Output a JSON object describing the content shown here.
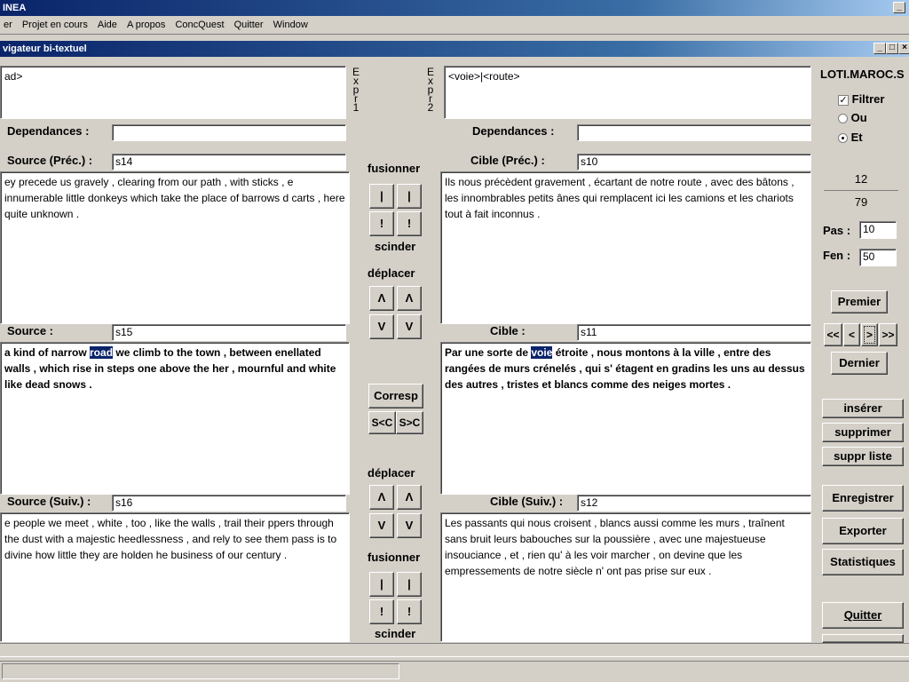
{
  "app": {
    "title": "INEA"
  },
  "menu": {
    "items": [
      "er",
      "Projet en cours",
      "Aide",
      "A propos",
      "ConcQuest",
      "Quitter",
      "Window"
    ]
  },
  "child": {
    "title": "vigateur bi-textuel"
  },
  "expr1": {
    "value": "ad>",
    "label": "Expr1"
  },
  "expr2": {
    "value": "<voie>|<route>",
    "label": "Expr2"
  },
  "left": {
    "dependances_label": "Dependances :",
    "dependances_value": "",
    "prev_label": "Source (Préc.) :",
    "prev_id": "s14",
    "prev_text": "ey precede us gravely , clearing from our path , with sticks , e innumerable little donkeys which take the place of barrows d carts , here quite unknown .",
    "cur_label": "Source :",
    "cur_id": "s15",
    "cur_text_before": " a kind of narrow ",
    "cur_highlight": "road",
    "cur_text_after": " we climb to the town , between enellated walls , which rise in steps one above the her , mournful and white like dead snows .",
    "next_label": "Source (Suiv.) :",
    "next_id": "s16",
    "next_text": "e people we meet , white , too , like the walls , trail their ppers through the dust with a majestic heedlessness , and rely to see them pass is to divine how little they are holden he business of our century ."
  },
  "right": {
    "dependances_label": "Dependances :",
    "dependances_value": "",
    "prev_label": "Cible (Préc.) :",
    "prev_id": "s10",
    "prev_text": "Ils nous précèdent gravement , écartant de notre route , avec des bâtons , les innombrables petits ânes qui remplacent ici les camions et les chariots tout à fait inconnus .",
    "cur_label": "Cible :",
    "cur_id": "s11",
    "cur_text_before": "Par une sorte de ",
    "cur_highlight": "voie",
    "cur_text_after": " étroite , nous montons à la ville , entre des rangées de murs crénelés , qui s' étagent en gradins les uns au dessus des autres , tristes et blancs comme des neiges mortes .",
    "next_label": "Cible (Suiv.) :",
    "next_id": "s12",
    "next_text": "Les passants qui nous croisent , blancs aussi comme les murs , traînent sans bruit leurs babouches sur la poussière , avec une majestueuse insouciance , et , rien qu' à les voir marcher , on devine que les empressements de notre siècle n' ont pas prise sur eux ."
  },
  "middle": {
    "fusionner": "fusionner",
    "scinder": "scinder",
    "deplacer": "déplacer",
    "bar": "|",
    "excl": "!",
    "up": "Λ",
    "down": "V",
    "corresp": "Corresp",
    "s_lt_c": "S<C",
    "s_gt_c": "S>C"
  },
  "side": {
    "corpus": "LOTI.MAROC.S",
    "filtrer": "Filtrer",
    "ou": "Ou",
    "et": "Et",
    "current": "12",
    "total": "79",
    "pas_label": "Pas :",
    "pas_value": "10",
    "fen_label": "Fen :",
    "fen_value": "50",
    "premier": "Premier",
    "first": "<<",
    "prev": "<",
    "next": ">",
    "last": ">>",
    "dernier": "Dernier",
    "inserer": "insérer",
    "supprimer": "supprimer",
    "suppr_liste": "suppr liste",
    "enregistrer": "Enregistrer",
    "exporter": "Exporter",
    "statistiques": "Statistiques",
    "quitter": "Quitter"
  }
}
